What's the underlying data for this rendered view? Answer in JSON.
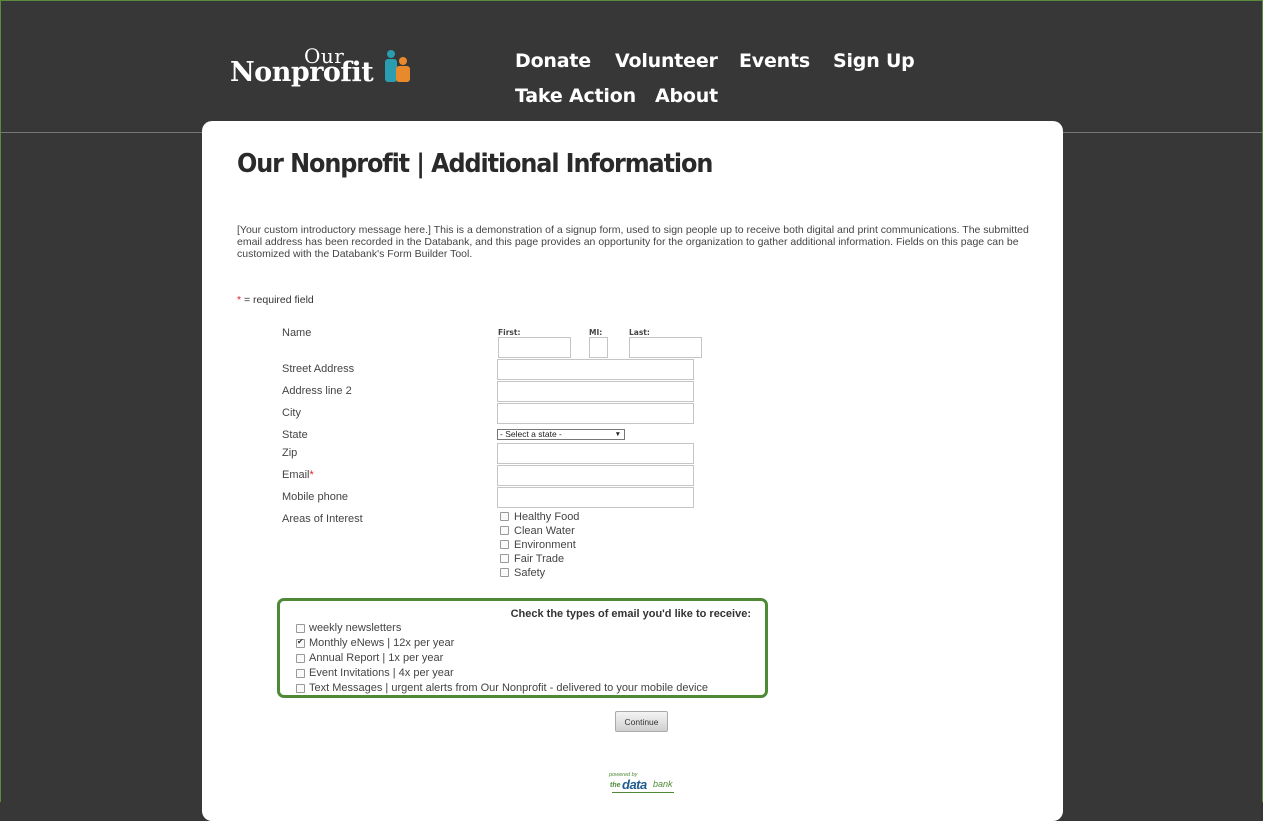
{
  "brand": {
    "line1": "Our",
    "line2": "Nonprofit",
    "icon": "people-icon"
  },
  "nav": [
    "Donate",
    "Volunteer",
    "Events",
    "Sign Up",
    "Take Action",
    "About"
  ],
  "page": {
    "title": "Our Nonprofit | Additional Information",
    "intro": "[Your custom introductory message here.] This is a demonstration of a signup form, used to sign people up to receive both digital and print communications. The submitted email address has been recorded in the Databank, and this page provides an opportunity for the organization to gather additional information. Fields on this page can be customized with the Databank's Form Builder Tool.",
    "required_star": "*",
    "required_note": " = required field"
  },
  "form": {
    "name_label": "Name",
    "first_label": "First:",
    "mi_label": "MI:",
    "last_label": "Last:",
    "street_label": "Street Address",
    "address2_label": "Address line 2",
    "city_label": "City",
    "state_label": "State",
    "state_selected": "- Select a state -",
    "zip_label": "Zip",
    "email_label": "Email",
    "email_star": "*",
    "mobile_label": "Mobile phone",
    "interests_label": "Areas of Interest",
    "interests": [
      "Healthy Food",
      "Clean Water",
      "Environment",
      "Fair Trade",
      "Safety"
    ]
  },
  "email_prefs": {
    "heading": "Check the types of email you'd like to receive:",
    "options": [
      {
        "label": "weekly newsletters",
        "checked": false
      },
      {
        "label": "Monthly eNews | 12x per year",
        "checked": true
      },
      {
        "label": "Annual Report | 1x per year",
        "checked": false
      },
      {
        "label": "Event Invitations | 4x per year",
        "checked": false
      },
      {
        "label": "Text Messages | urgent alerts from Our Nonprofit - delivered to your mobile device",
        "checked": false
      }
    ]
  },
  "continue_label": "Continue",
  "footer": {
    "powered_by": "powered by",
    "brand_the": "the",
    "brand_data": "data",
    "brand_bank": "bank"
  },
  "colors": {
    "background": "#373737",
    "accent_green": "#4e8a36",
    "required_red": "#d22222",
    "brand_blue": "#1f5b8f",
    "brand_orange": "#e8892b",
    "brand_teal": "#2a9db0"
  }
}
